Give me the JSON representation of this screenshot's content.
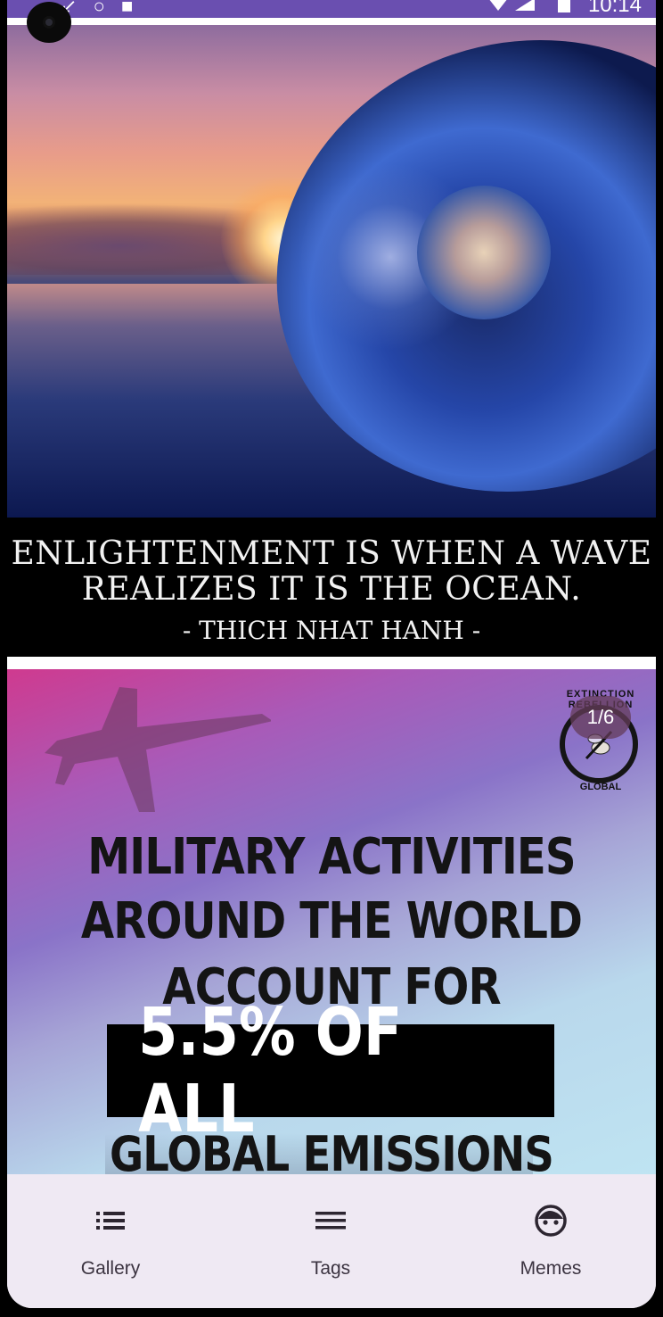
{
  "status_bar": {
    "time": "10:14",
    "left_icons": "↙ ○ ■"
  },
  "posts": [
    {
      "quote_line1": "ENLIGHTENMENT IS WHEN A WAVE",
      "quote_line2": "REALIZES IT IS THE OCEAN.",
      "attribution": "- THICH NHAT HANH -"
    },
    {
      "counter": "1/6",
      "badge_top": "EXTINCTION REBELLION",
      "badge_bottom": "GLOBAL",
      "headline1": "MILITARY ACTIVITIES",
      "headline2": "AROUND THE WORLD",
      "headline3": "ACCOUNT FOR",
      "highlight": "5.5% OF ALL",
      "headline4": "GLOBAL EMISSIONS"
    }
  ],
  "bottom_nav": {
    "items": [
      {
        "label": "Gallery",
        "icon": "list-icon"
      },
      {
        "label": "Tags",
        "icon": "menu-icon"
      },
      {
        "label": "Memes",
        "icon": "face-icon"
      }
    ],
    "background": "#efe9f3"
  },
  "colors": {
    "status_bar": "#6a4fb0"
  }
}
